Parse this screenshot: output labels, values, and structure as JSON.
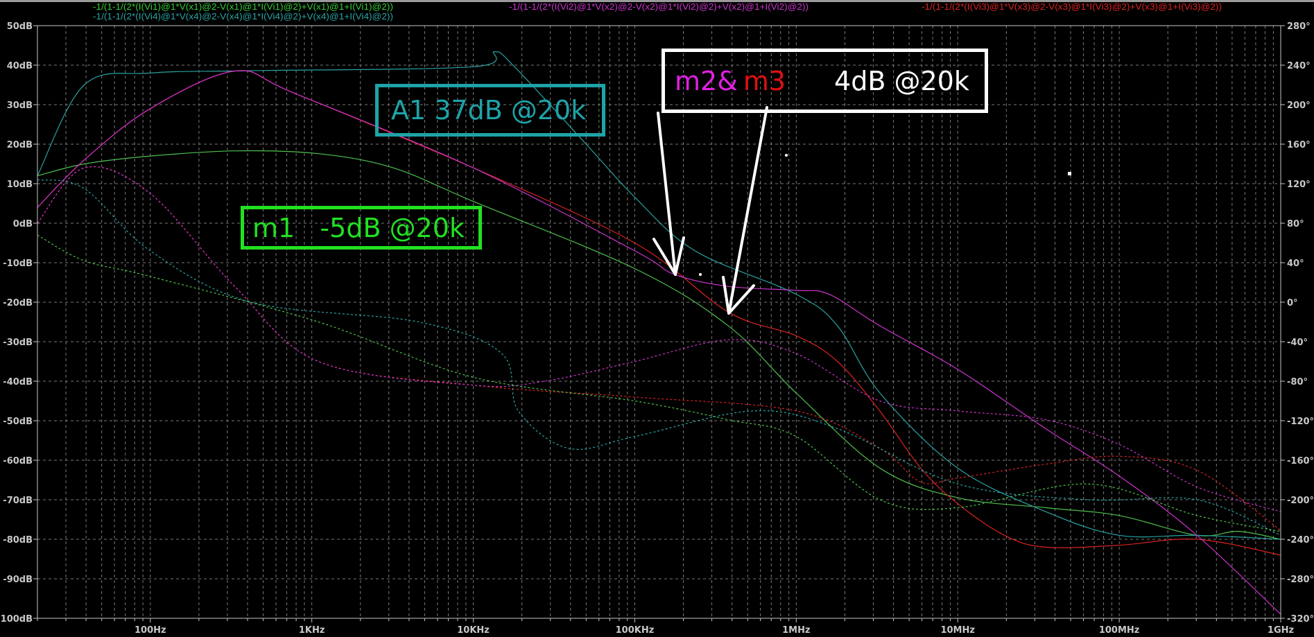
{
  "chart_data": {
    "type": "line",
    "title": "",
    "xscale": "log",
    "xlim": [
      20,
      1000000000
    ],
    "ylim": [
      -100,
      50
    ],
    "y2lim": [
      -320,
      280
    ],
    "xlabel": "",
    "ylabel": "",
    "grid": true,
    "x_ticks": [
      {
        "value": 100,
        "label": "100Hz"
      },
      {
        "value": 1000,
        "label": "1KHz"
      },
      {
        "value": 10000,
        "label": "10KHz"
      },
      {
        "value": 100000,
        "label": "100KHz"
      },
      {
        "value": 1000000,
        "label": "1MHz"
      },
      {
        "value": 10000000,
        "label": "10MHz"
      },
      {
        "value": 100000000,
        "label": "100MHz"
      },
      {
        "value": 1000000000,
        "label": "1GHz"
      }
    ],
    "y_ticks": [
      "50dB",
      "40dB",
      "30dB",
      "20dB",
      "10dB",
      "0dB",
      "-10dB",
      "-20dB",
      "-30dB",
      "-40dB",
      "-50dB",
      "-60dB",
      "-70dB",
      "-80dB",
      "-90dB",
      "-100dB"
    ],
    "y2_ticks": [
      "280°",
      "240°",
      "200°",
      "160°",
      "120°",
      "80°",
      "40°",
      "0°",
      "-40°",
      "-80°",
      "-120°",
      "-160°",
      "-200°",
      "-240°",
      "-280°",
      "-320°"
    ],
    "legend": [
      {
        "label": "-1/(1-1/(2*(I(Vi1)@1*V(x1)@2-V(x1)@1*I(Vi1)@2)+V(x1)@1+I(Vi1)@2))",
        "color": "#33cc33"
      },
      {
        "label": "-1/(1-1/(2*(I(Vi4)@1*V(x4)@2-V(x4)@1*I(Vi4)@2)+V(x4)@1+I(Vi4)@2))",
        "color": "#2aa3a3"
      },
      {
        "label": "-1/(1-1/(2*(I(Vi2)@1*V(x2)@2-V(x2)@1*I(Vi2)@2)+V(x2)@1+I(Vi2)@2))",
        "color": "#cc33cc"
      },
      {
        "label": "-1/(1-1/(2*(I(Vi3)@1*V(x3)@2-V(x3)@1*I(Vi3)@2)+V(x3)@1+I(Vi3)@2))",
        "color": "#dd2222"
      }
    ],
    "series": [
      {
        "name": "Vi1 magnitude",
        "axis": "dB",
        "style": "solid",
        "color": "#4ec24e",
        "points": [
          [
            20,
            12
          ],
          [
            39,
            15
          ],
          [
            100,
            17
          ],
          [
            333,
            18.3
          ],
          [
            1100,
            17.6
          ],
          [
            3200,
            14
          ],
          [
            10000,
            5.5
          ],
          [
            100000,
            -11.5
          ],
          [
            380000,
            -26
          ],
          [
            1000000,
            -43
          ],
          [
            3300000,
            -62
          ],
          [
            10000000,
            -69.5
          ],
          [
            35000000,
            -72
          ],
          [
            100000000,
            -74
          ],
          [
            303000000,
            -79
          ],
          [
            551000000,
            -78
          ],
          [
            1000000000,
            -80
          ]
        ]
      },
      {
        "name": "Vi4 magnitude",
        "axis": "dB",
        "style": "solid",
        "color": "#2aa3a3",
        "points": [
          [
            20,
            12
          ],
          [
            39,
            35
          ],
          [
            100,
            38
          ],
          [
            424,
            38.6
          ],
          [
            10000,
            39.6
          ],
          [
            13500,
            43.4
          ],
          [
            18000,
            39.6
          ],
          [
            50000,
            20
          ],
          [
            100000,
            6.6
          ],
          [
            236000,
            -7
          ],
          [
            1000000,
            -18
          ],
          [
            1800000,
            -26
          ],
          [
            3300000,
            -43
          ],
          [
            10000000,
            -62
          ],
          [
            35000000,
            -73
          ],
          [
            100000000,
            -79
          ],
          [
            303000000,
            -79
          ],
          [
            1000000000,
            -80
          ]
        ]
      },
      {
        "name": "Vi3 magnitude",
        "axis": "dB",
        "style": "solid",
        "color": "#dd2222",
        "points": [
          [
            20,
            4
          ],
          [
            39,
            16
          ],
          [
            100,
            29
          ],
          [
            333,
            38.5
          ],
          [
            769,
            33
          ],
          [
            10000,
            14
          ],
          [
            100000,
            -5
          ],
          [
            380000,
            -22.5
          ],
          [
            1000000,
            -28.5
          ],
          [
            1800000,
            -35
          ],
          [
            3300000,
            -47.6
          ],
          [
            5900000,
            -62
          ],
          [
            10000000,
            -71
          ],
          [
            19500000,
            -79
          ],
          [
            35000000,
            -82
          ],
          [
            100000000,
            -81.5
          ],
          [
            303000000,
            -80
          ],
          [
            1000000000,
            -84
          ]
        ]
      },
      {
        "name": "Vi2 magnitude",
        "axis": "dB",
        "style": "solid",
        "color": "#cc33cc",
        "points": [
          [
            20,
            4
          ],
          [
            39,
            16
          ],
          [
            100,
            29
          ],
          [
            333,
            38.5
          ],
          [
            769,
            33
          ],
          [
            10000,
            14
          ],
          [
            100000,
            -7
          ],
          [
            177000,
            -13
          ],
          [
            380000,
            -16
          ],
          [
            1000000,
            -17
          ],
          [
            1600000,
            -18
          ],
          [
            3300000,
            -26
          ],
          [
            10000000,
            -37
          ],
          [
            35000000,
            -52
          ],
          [
            100000000,
            -64
          ],
          [
            303000000,
            -79
          ],
          [
            1000000000,
            -99
          ]
        ]
      },
      {
        "name": "Vi3 phase",
        "axis": "deg",
        "style": "dashed",
        "color": "#dd2222",
        "points": [
          [
            20,
            80
          ],
          [
            39,
            136
          ],
          [
            100,
            110
          ],
          [
            333,
            16
          ],
          [
            1100,
            -60
          ],
          [
            10000,
            -84
          ],
          [
            100000,
            -96
          ],
          [
            1000000,
            -110
          ],
          [
            3300000,
            -148
          ],
          [
            5900000,
            -182
          ],
          [
            10000000,
            -178
          ],
          [
            35000000,
            -164
          ],
          [
            100000000,
            -156
          ],
          [
            303000000,
            -170
          ],
          [
            1000000000,
            -231
          ]
        ]
      },
      {
        "name": "Vi2 phase",
        "axis": "deg",
        "style": "dashed",
        "color": "#cc33cc",
        "points": [
          [
            20,
            80
          ],
          [
            39,
            136
          ],
          [
            100,
            110
          ],
          [
            333,
            16
          ],
          [
            1100,
            -60
          ],
          [
            10000,
            -84
          ],
          [
            27500,
            -80
          ],
          [
            100000,
            -60
          ],
          [
            380000,
            -38
          ],
          [
            1000000,
            -52
          ],
          [
            3300000,
            -100
          ],
          [
            10000000,
            -110
          ],
          [
            35000000,
            -119
          ],
          [
            100000000,
            -144
          ],
          [
            303000000,
            -187
          ],
          [
            1000000000,
            -212
          ]
        ]
      },
      {
        "name": "Vi4 phase",
        "axis": "deg",
        "style": "dashed",
        "color": "#2aa3a3",
        "points": [
          [
            20,
            124
          ],
          [
            39,
            115
          ],
          [
            100,
            52
          ],
          [
            424,
            0
          ],
          [
            4600,
            -20
          ],
          [
            15000,
            -52
          ],
          [
            19000,
            -110
          ],
          [
            39000,
            -148
          ],
          [
            100000,
            -136
          ],
          [
            544000,
            -110
          ],
          [
            1800000,
            -128
          ],
          [
            10000000,
            -184
          ],
          [
            64000000,
            -200
          ],
          [
            303000000,
            -200
          ],
          [
            1000000000,
            -236
          ]
        ]
      },
      {
        "name": "Vi1 phase",
        "axis": "deg",
        "style": "dashed",
        "color": "#4ec24e",
        "points": [
          [
            20,
            68
          ],
          [
            39,
            42
          ],
          [
            100,
            26
          ],
          [
            1100,
            -20
          ],
          [
            10000,
            -76
          ],
          [
            100000,
            -100
          ],
          [
            380000,
            -119
          ],
          [
            1000000,
            -136
          ],
          [
            3300000,
            -200
          ],
          [
            10000000,
            -208
          ],
          [
            64000000,
            -184
          ],
          [
            303000000,
            -216
          ],
          [
            1000000000,
            -232
          ]
        ]
      }
    ],
    "annotations": {
      "a1": "A1 37dB @20k",
      "m1": "m1   -5dB @20k",
      "m2": "m2&",
      "m3": "m3",
      "m23_value": "4dB @20k"
    }
  }
}
